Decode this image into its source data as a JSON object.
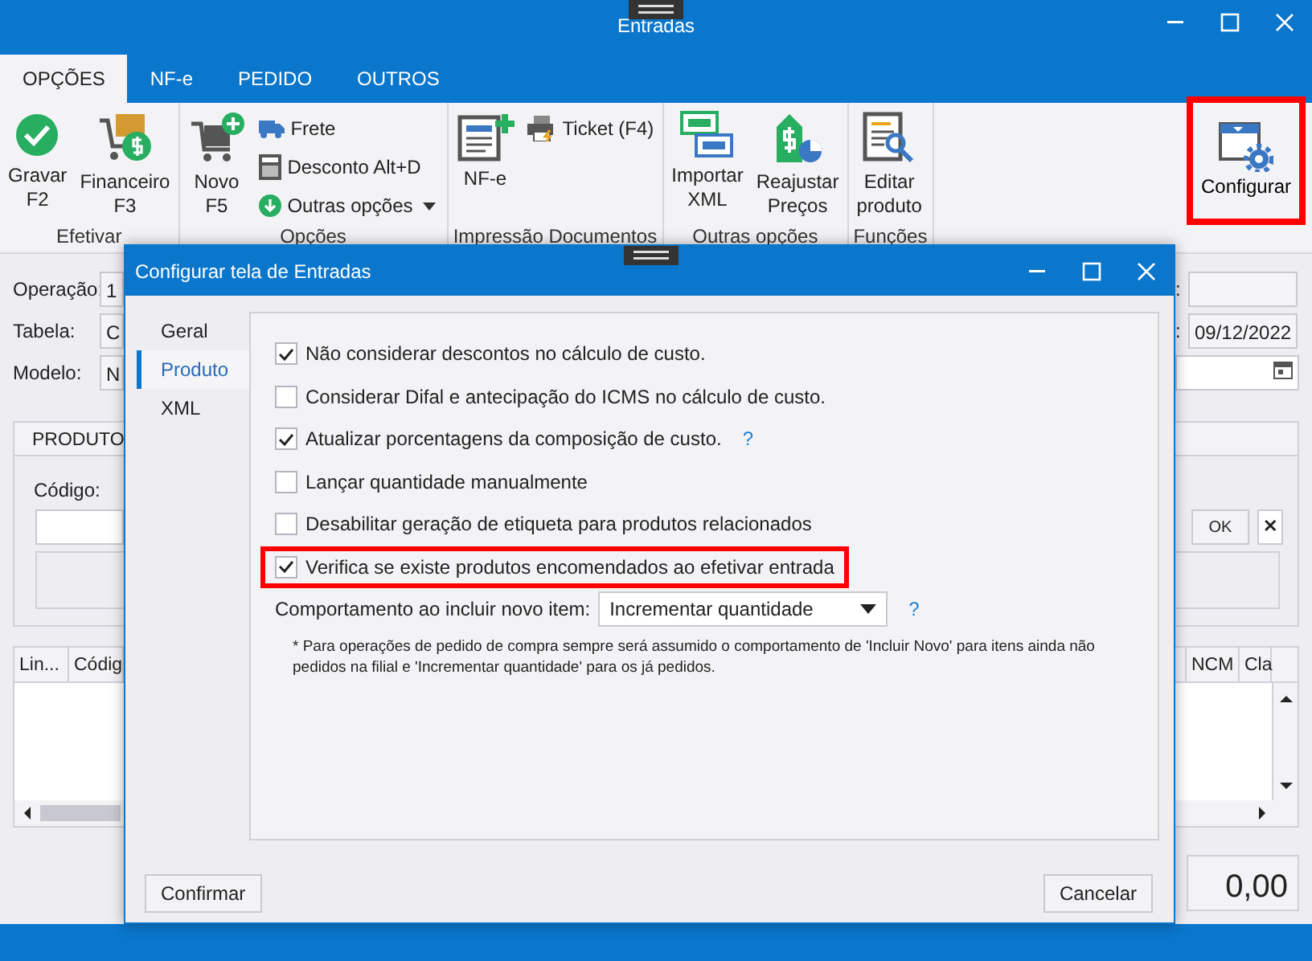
{
  "window": {
    "title": "Entradas"
  },
  "tabs": [
    {
      "label": "OPÇÕES",
      "selected": true
    },
    {
      "label": "NF-e",
      "selected": false
    },
    {
      "label": "PEDIDO",
      "selected": false
    },
    {
      "label": "OUTROS",
      "selected": false
    }
  ],
  "ribbon": {
    "groups": [
      {
        "label": "Efetivar",
        "items": [
          {
            "kind": "large",
            "lines": [
              "Gravar",
              "F2"
            ]
          },
          {
            "kind": "large",
            "lines": [
              "Financeiro",
              "F3"
            ]
          }
        ]
      },
      {
        "label": "Opções",
        "items": [
          {
            "kind": "large",
            "lines": [
              "Novo",
              "F5"
            ]
          },
          {
            "kind": "small",
            "label": "Frete",
            "has_menu": false
          },
          {
            "kind": "small",
            "label": "Desconto Alt+D",
            "has_menu": false
          },
          {
            "kind": "small",
            "label": "Outras opções",
            "has_menu": true
          }
        ]
      },
      {
        "label": "Impressão Documentos",
        "items": [
          {
            "kind": "large",
            "lines": [
              "NF-e"
            ]
          },
          {
            "kind": "small",
            "label": "Ticket (F4)",
            "has_menu": false
          }
        ]
      },
      {
        "label": "Outras opções",
        "items": [
          {
            "kind": "large",
            "lines": [
              "Importar",
              "XML"
            ]
          },
          {
            "kind": "large",
            "lines": [
              "Reajustar",
              "Preços"
            ]
          }
        ]
      },
      {
        "label": "Funções",
        "items": [
          {
            "kind": "large",
            "lines": [
              "Editar",
              "produto"
            ]
          }
        ]
      }
    ],
    "configure_button": {
      "label": "Configurar",
      "highlighted": true
    }
  },
  "form": {
    "left_fields": [
      {
        "label": "Operação:",
        "value": "1"
      },
      {
        "label": "Tabela:",
        "value": "C"
      },
      {
        "label": "Modelo:",
        "value": "N"
      }
    ],
    "right_fields": [
      {
        "label": ":"
      },
      {
        "label": ":",
        "value": "09/12/2022"
      }
    ]
  },
  "products": {
    "title": "PRODUTO",
    "code_label": "Código:",
    "ok": "OK",
    "clear": "✕"
  },
  "table": {
    "columns": [
      "Lin...",
      "Códig",
      "NCM",
      "Cla"
    ]
  },
  "total": "0,00",
  "dialog": {
    "title": "Configurar tela de Entradas",
    "nav": [
      {
        "label": "Geral",
        "selected": false
      },
      {
        "label": "Produto",
        "selected": true
      },
      {
        "label": "XML",
        "selected": false
      }
    ],
    "options": [
      {
        "label": "Não considerar descontos no cálculo de custo.",
        "checked": true,
        "highlighted": false
      },
      {
        "label": "Considerar Difal e antecipação do ICMS no cálculo de custo.",
        "checked": false,
        "highlighted": false
      },
      {
        "label": "Atualizar porcentagens da composição de custo.",
        "checked": true,
        "highlighted": false,
        "help": "?"
      },
      {
        "label": "Lançar quantidade manualmente",
        "checked": false,
        "highlighted": false
      },
      {
        "label": "Desabilitar geração de etiqueta para produtos relacionados",
        "checked": false,
        "highlighted": false
      },
      {
        "label": "Verifica se existe produtos encomendados ao efetivar entrada",
        "checked": true,
        "highlighted": true
      }
    ],
    "behavior": {
      "label": "Comportamento ao incluir novo item:",
      "value": "Incrementar quantidade",
      "help": "?"
    },
    "note": "* Para operações de pedido de compra sempre será assumido o comportamento de 'Incluir Novo' para itens ainda não pedidos na filial e 'Incrementar quantidade' para os já pedidos.",
    "buttons": [
      {
        "label": "Confirmar"
      },
      {
        "label": "Cancelar"
      }
    ]
  }
}
